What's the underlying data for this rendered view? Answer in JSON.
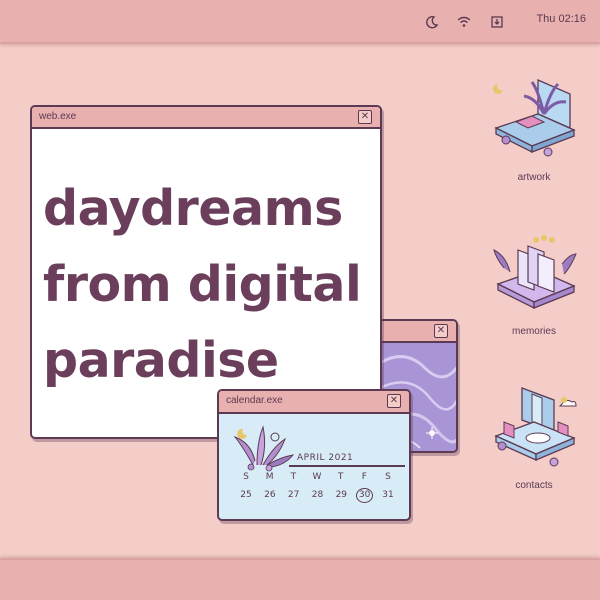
{
  "topbar": {
    "icons": [
      "moon-icon",
      "wifi-icon",
      "download-icon"
    ],
    "clock": "Thu 02:16"
  },
  "windows": {
    "web": {
      "title": "web.exe",
      "headline_lines": [
        "daydreams",
        "from digital",
        "paradise"
      ]
    },
    "image": {
      "title": ""
    },
    "calendar": {
      "title": "calendar.exe",
      "month": "APRIL 2021",
      "weekdays": [
        "S",
        "M",
        "T",
        "W",
        "T",
        "F",
        "S"
      ],
      "days": [
        "25",
        "26",
        "27",
        "28",
        "29",
        "30",
        "31"
      ],
      "highlighted_day": "30"
    }
  },
  "desktop_icons": [
    {
      "label": "artwork",
      "icon": "laptop-palm-icon"
    },
    {
      "label": "memories",
      "icon": "laptop-photos-icon"
    },
    {
      "label": "contacts",
      "icon": "laptop-waterfall-icon"
    }
  ],
  "colors": {
    "background": "#f4cdc9",
    "bar": "#e8b0ae",
    "text": "#6b3f5c",
    "calendar_bg": "#d8ecf7",
    "purple": "#a58dd0"
  }
}
